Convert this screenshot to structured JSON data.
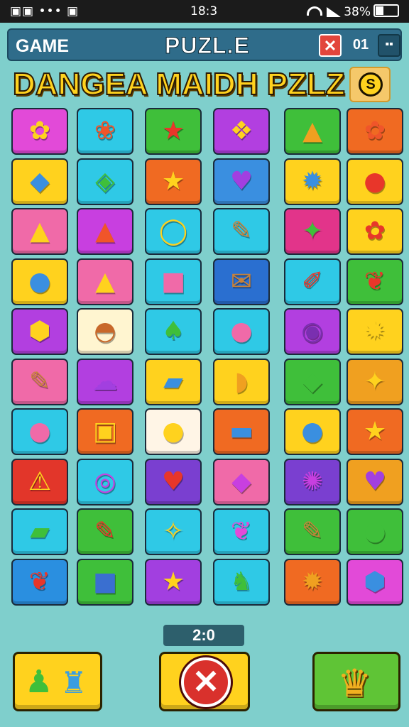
{
  "status_bar": {
    "left_icons": "▣▣ ••• ▣",
    "time": "18:3",
    "battery": "38%"
  },
  "header": {
    "left_label": "GAME",
    "title": "PUZL.E",
    "close_icon": "close-icon",
    "score": "01",
    "menu_icon": "grid-menu-icon"
  },
  "banner": {
    "title": "DANGEA MAIDH PZLZ",
    "coin_symbol": "S"
  },
  "timer": "2:0",
  "board": {
    "columns": 6,
    "rows": 10,
    "tiles": [
      [
        {
          "c": "#e24ad8",
          "i": "✿",
          "ic": "#ffd21e"
        },
        {
          "c": "#2fc9e6",
          "i": "❀",
          "ic": "#f0552a"
        },
        {
          "c": "#3fbf3a",
          "i": "★",
          "ic": "#e8362a"
        },
        {
          "c": "#b23fe0",
          "i": "❖",
          "ic": "#ffd21e"
        },
        {
          "c": "#3fbf3a",
          "i": "▲",
          "ic": "#f0a020"
        },
        {
          "c": "#f06a22",
          "i": "✿",
          "ic": "#f0552a"
        }
      ],
      [
        {
          "c": "#ffd21e",
          "i": "◆",
          "ic": "#3a8fe0"
        },
        {
          "c": "#2fc9e6",
          "i": "◈",
          "ic": "#3fbf3a"
        },
        {
          "c": "#f06a22",
          "i": "★",
          "ic": "#ffd21e"
        },
        {
          "c": "#3a8fe0",
          "i": "♥",
          "ic": "#a23fe0"
        },
        {
          "c": "#ffd21e",
          "i": "✹",
          "ic": "#3a8fe0"
        },
        {
          "c": "#ffd21e",
          "i": "●",
          "ic": "#e8362a"
        }
      ],
      [
        {
          "c": "#f06aa8",
          "i": "▲",
          "ic": "#ffd21e"
        },
        {
          "c": "#c83fe0",
          "i": "▲",
          "ic": "#f0552a"
        },
        {
          "c": "#2fc9e6",
          "i": "◯",
          "ic": "#ffd21e"
        },
        {
          "c": "#2fc9e6",
          "i": "✎",
          "ic": "#c8823a"
        },
        {
          "c": "#e2348a",
          "i": "✦",
          "ic": "#3fbf3a"
        },
        {
          "c": "#ffd21e",
          "i": "✿",
          "ic": "#e8362a"
        }
      ],
      [
        {
          "c": "#ffd21e",
          "i": "●",
          "ic": "#3a8fe0"
        },
        {
          "c": "#f06aa8",
          "i": "▲",
          "ic": "#ffd21e"
        },
        {
          "c": "#2fc9e6",
          "i": "■",
          "ic": "#f06aa8"
        },
        {
          "c": "#2a6fd0",
          "i": "✉",
          "ic": "#c8823a"
        },
        {
          "c": "#2fc9e6",
          "i": "✐",
          "ic": "#e8362a"
        },
        {
          "c": "#3fbf3a",
          "i": "❦",
          "ic": "#e8362a"
        }
      ],
      [
        {
          "c": "#b23fe0",
          "i": "⬢",
          "ic": "#ffd21e"
        },
        {
          "c": "#fff5d0",
          "i": "◓",
          "ic": "#c8682a"
        },
        {
          "c": "#2fc9e6",
          "i": "♠",
          "ic": "#3fbf3a"
        },
        {
          "c": "#2fc9e6",
          "i": "●",
          "ic": "#f06aa8"
        },
        {
          "c": "#b23fe0",
          "i": "◉",
          "ic": "#7a2fb0"
        },
        {
          "c": "#ffd21e",
          "i": "✹",
          "ic": "#ffd21e"
        }
      ],
      [
        {
          "c": "#f06aa8",
          "i": "✎",
          "ic": "#c8823a"
        },
        {
          "c": "#b23fe0",
          "i": "☁",
          "ic": "#a23fe0"
        },
        {
          "c": "#ffd21e",
          "i": "▰",
          "ic": "#3a8fe0"
        },
        {
          "c": "#ffd21e",
          "i": "◗",
          "ic": "#f0a020"
        },
        {
          "c": "#3fbf3a",
          "i": "◆",
          "ic": "#3fbf3a"
        },
        {
          "c": "#f0a020",
          "i": "✦",
          "ic": "#ffd21e"
        }
      ],
      [
        {
          "c": "#2fc9e6",
          "i": "●",
          "ic": "#f06aa8"
        },
        {
          "c": "#f06a22",
          "i": "▣",
          "ic": "#ffd21e"
        },
        {
          "c": "#fff5e6",
          "i": "●",
          "ic": "#ffd21e"
        },
        {
          "c": "#f06a22",
          "i": "▬",
          "ic": "#3a8fe0"
        },
        {
          "c": "#ffd21e",
          "i": "●",
          "ic": "#3a8fe0"
        },
        {
          "c": "#f06a22",
          "i": "★",
          "ic": "#ffd21e"
        }
      ],
      [
        {
          "c": "#e2362a",
          "i": "⚠",
          "ic": "#ffd21e"
        },
        {
          "c": "#2fc9e6",
          "i": "◎",
          "ic": "#c83fe0"
        },
        {
          "c": "#7a3fd0",
          "i": "♥",
          "ic": "#e8362a"
        },
        {
          "c": "#f06aa8",
          "i": "◆",
          "ic": "#c83fe0"
        },
        {
          "c": "#7a3fd0",
          "i": "✺",
          "ic": "#c83fe0"
        },
        {
          "c": "#f0a020",
          "i": "♥",
          "ic": "#a23fe0"
        }
      ],
      [
        {
          "c": "#2fc9e6",
          "i": "▰",
          "ic": "#3fbf3a"
        },
        {
          "c": "#3fbf3a",
          "i": "✎",
          "ic": "#e8362a"
        },
        {
          "c": "#2fc9e6",
          "i": "✧",
          "ic": "#ffd21e"
        },
        {
          "c": "#2fc9e6",
          "i": "❦",
          "ic": "#e24ad8"
        },
        {
          "c": "#3fbf3a",
          "i": "✎",
          "ic": "#c8823a"
        },
        {
          "c": "#3fbf3a",
          "i": "●",
          "ic": "#3fbf3a"
        }
      ],
      [
        {
          "c": "#2a8fe0",
          "i": "❦",
          "ic": "#e8362a"
        },
        {
          "c": "#3fbf3a",
          "i": "■",
          "ic": "#3a6fd0"
        },
        {
          "c": "#a23fe0",
          "i": "★",
          "ic": "#ffd21e"
        },
        {
          "c": "#2fc9e6",
          "i": "♞",
          "ic": "#3fbf3a"
        },
        {
          "c": "#f06a22",
          "i": "✹",
          "ic": "#f0a020"
        },
        {
          "c": "#e24ad8",
          "i": "⬢",
          "ic": "#3a8fe0"
        }
      ]
    ]
  },
  "buttons": {
    "left_icons": [
      "potion-icon",
      "bottle-icon"
    ],
    "middle_icon": "cancel-x-icon",
    "right_icon": "treasure-icon"
  }
}
